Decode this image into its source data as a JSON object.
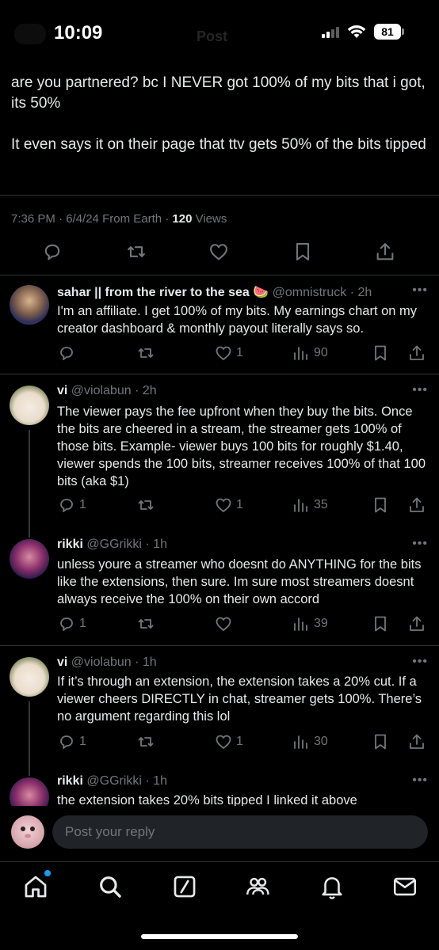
{
  "status": {
    "time": "10:09",
    "battery": "81",
    "nav_title": "Post"
  },
  "main_post": {
    "paragraphs": [
      "are you partnered? bc I NEVER got 100% of my bits that i got, its 50%",
      "It even says it on their page that ttv gets 50% of the bits tipped"
    ],
    "meta_prefix": "7:36 PM · 6/4/24 From Earth · ",
    "views_count": "120",
    "views_label": " Views"
  },
  "replies": [
    {
      "name": "sahar || from the river to the sea 🍉",
      "handle": "@omnistruck · 2h",
      "text": "I'm an affiliate. I get 100% of my bits. My earnings chart on my creator dashboard & monthly payout literally says so.",
      "replies": "",
      "likes": "1",
      "views": "90"
    },
    {
      "name": "vi",
      "handle": "@violabun · 2h",
      "text": "The viewer pays the fee upfront when they buy the bits. Once the bits are cheered in a stream, the streamer gets 100% of those bits. Example- viewer buys 100 bits for roughly $1.40, viewer spends the 100 bits, streamer receives 100% of that 100 bits (aka $1)",
      "replies": "1",
      "likes": "1",
      "views": "35"
    },
    {
      "name": "rikki",
      "handle": "@GGrikki · 1h",
      "text": "unless youre a streamer who doesnt do ANYTHING for the bits like the extensions, then sure. Im sure most streamers doesnt always receive the 100% on their own accord",
      "replies": "1",
      "likes": "",
      "views": "39"
    },
    {
      "name": "vi",
      "handle": "@violabun · 1h",
      "text": "If it’s through an extension, the extension takes a 20% cut. If a viewer cheers DIRECTLY in chat, streamer gets 100%. There’s no argument regarding this lol",
      "replies": "1",
      "likes": "1",
      "views": "30"
    },
    {
      "name": "rikki",
      "handle": "@GGrikki · 1h",
      "text": "the extension takes 20% bits tipped I linked it above"
    }
  ],
  "reply_bar": {
    "placeholder": "Post your reply"
  },
  "icons": {
    "reply": "reply-icon",
    "repost": "repost-icon",
    "like": "heart-icon",
    "bookmark": "bookmark-icon",
    "share": "share-icon",
    "views": "views-icon",
    "tabs": [
      "home-icon",
      "search-icon",
      "grok-icon",
      "communities-icon",
      "notifications-icon",
      "messages-icon"
    ]
  },
  "colors": {
    "background": "#000000",
    "text": "#e7e9ea",
    "muted": "#71767b",
    "accent": "#1d9bf0",
    "divider": "#2f3336"
  }
}
